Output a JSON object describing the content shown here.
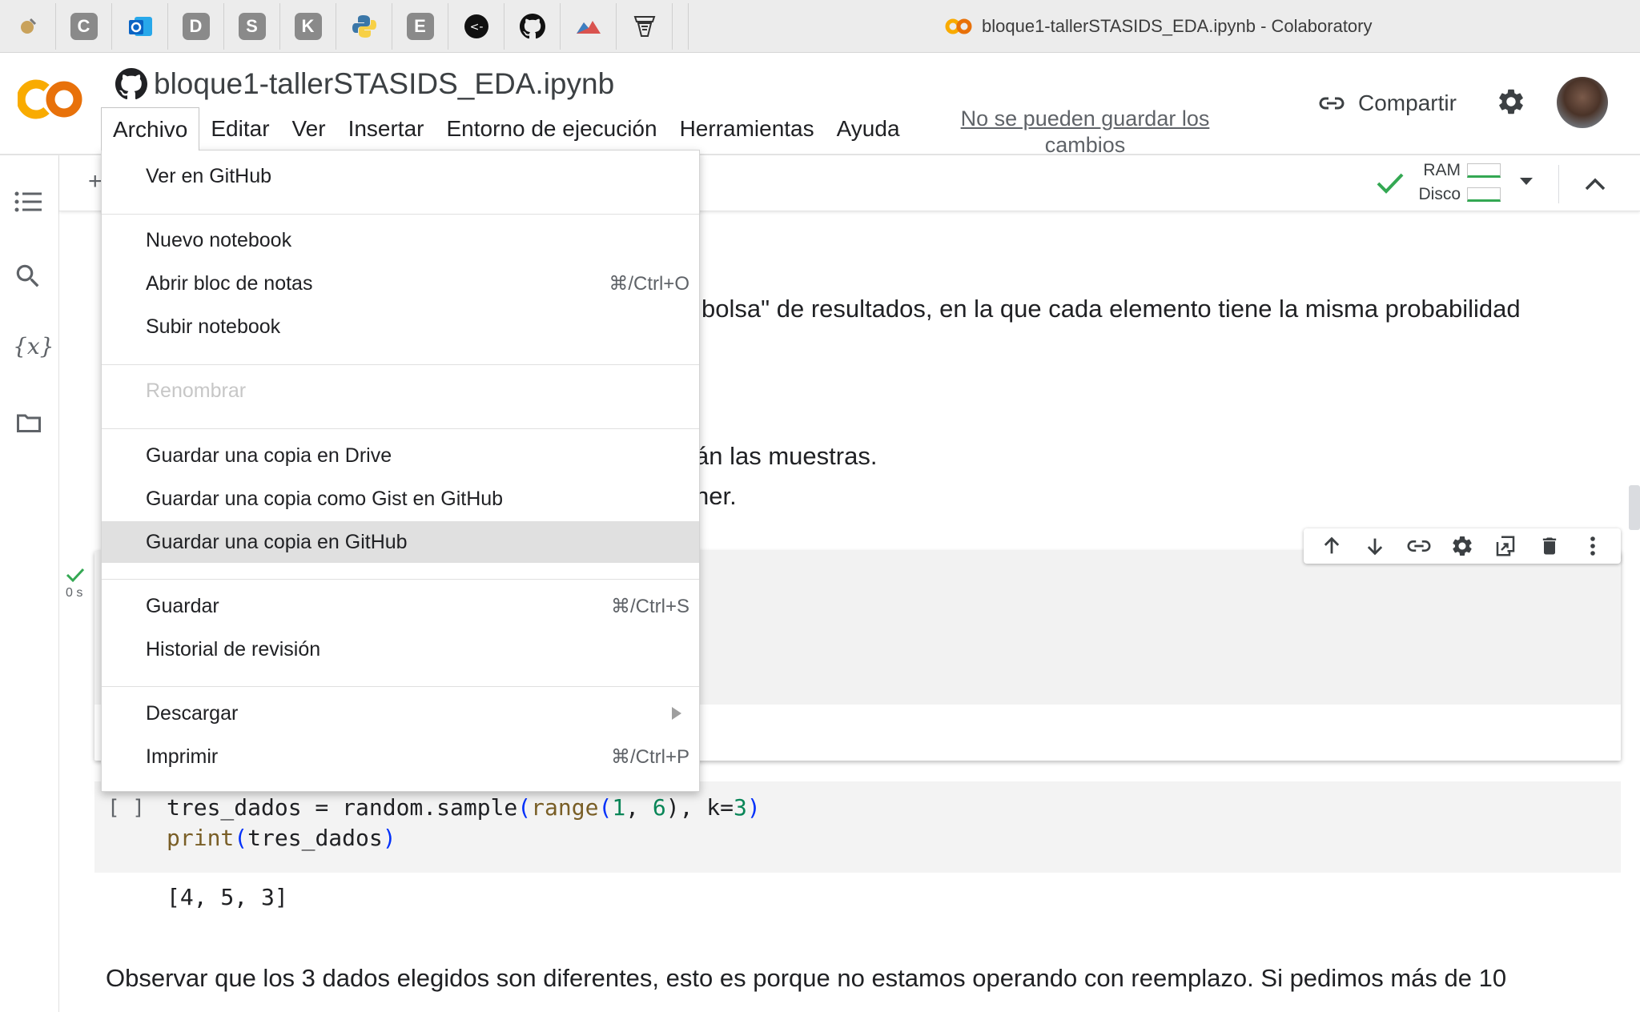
{
  "browser": {
    "window_title": "bloque1-tallerSTASIDS_EDA.ipynb - Colaboratory",
    "bookmarks": [
      {
        "icon": "misc-bookmark-icon"
      },
      {
        "letter": "C"
      },
      {
        "icon": "outlook-icon"
      },
      {
        "letter": "D"
      },
      {
        "letter": "S"
      },
      {
        "letter": "K"
      },
      {
        "icon": "python-icon"
      },
      {
        "letter": "E"
      },
      {
        "icon": "back-arrow-circle-icon"
      },
      {
        "icon": "github-icon"
      },
      {
        "icon": "mountain-icon"
      },
      {
        "icon": "terminal-icon"
      }
    ]
  },
  "header": {
    "notebook_title": "bloque1-tallerSTASIDS_EDA.ipynb",
    "menu": [
      "Archivo",
      "Editar",
      "Ver",
      "Insertar",
      "Entorno de ejecución",
      "Herramientas",
      "Ayuda"
    ],
    "save_warning": "No se pueden guardar los cambios",
    "share_label": "Compartir",
    "brand_color": "#f9ab00"
  },
  "toolbar": {
    "ram_label": "RAM",
    "disk_label": "Disco"
  },
  "file_menu": {
    "items": [
      {
        "label": "Ver en GitHub"
      },
      {
        "label": "Nuevo notebook"
      },
      {
        "label": "Abrir bloc de notas",
        "shortcut": "⌘/Ctrl+O"
      },
      {
        "label": "Subir notebook"
      },
      {
        "label": "Renombrar",
        "disabled": true
      },
      {
        "label": "Guardar una copia en Drive"
      },
      {
        "label": "Guardar una copia como Gist en GitHub"
      },
      {
        "label": "Guardar una copia en GitHub",
        "highlighted": true
      },
      {
        "label": "Guardar",
        "shortcut": "⌘/Ctrl+S"
      },
      {
        "label": "Historial de revisión"
      },
      {
        "label": "Descargar",
        "submenu": true
      },
      {
        "label": "Imprimir",
        "shortcut": "⌘/Ctrl+P"
      }
    ]
  },
  "notebook": {
    "text_fragment_1": "bolsa\" de resultados, en la que cada elemento tiene la misma probabilidad",
    "text_fragment_2": "án las muestras.",
    "text_fragment_3": "ner.",
    "cell_exec_time": "0 s",
    "code_run_brackets": "[ ]",
    "code_line_1": {
      "a": "tres_dados = random.sample",
      "b": "(",
      "c": "range",
      "d": "(",
      "e": "1",
      "f": ", ",
      "g": "6",
      "h": "), k=",
      "i": "3",
      "j": ")"
    },
    "code_line_2": {
      "a": "print",
      "b": "(",
      "c": "tres_dados",
      "d": ")"
    },
    "output": "[4, 5, 3]",
    "bottom_paragraph": "Observar que los 3 dados elegidos son diferentes, esto es porque no estamos operando con reemplazo. Si pedimos más de 10"
  }
}
